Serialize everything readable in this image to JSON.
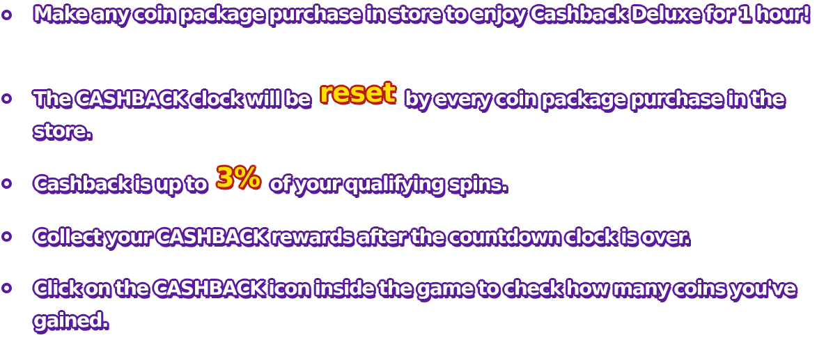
{
  "rules": [
    {
      "text": "Make any coin package purchase in store to enjoy Cashback Deluxe for 1 hour!"
    },
    {
      "before": "The CASHBACK clock will be",
      "highlight": "reset",
      "after": "by every coin package purchase in the store."
    },
    {
      "before": "Cashback is up to",
      "highlight": "3%",
      "after": "of your qualifying spins."
    },
    {
      "text": "Collect your CASHBACK rewards after the countdown clock is over."
    },
    {
      "text": "Click on the CASHBACK icon inside the game to check how many coins you've gained."
    }
  ],
  "colors": {
    "text_fill": "#ffffff",
    "text_outline": "#5a1a9c",
    "highlight_fill": "#ffe000",
    "highlight_outline": "#b81c10",
    "background": "#ffffff"
  }
}
